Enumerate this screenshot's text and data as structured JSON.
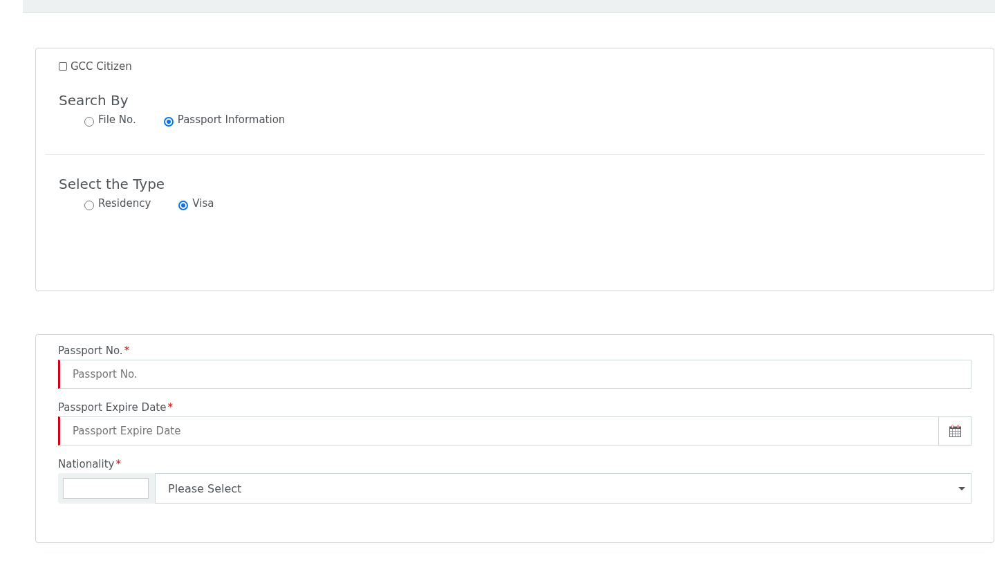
{
  "gcc_citizen": {
    "label": "GCC Citizen",
    "checked": false
  },
  "search_by": {
    "heading": "Search By",
    "options": [
      {
        "label": "File No.",
        "selected": false
      },
      {
        "label": "Passport Information",
        "selected": true
      }
    ]
  },
  "select_type": {
    "heading": "Select the Type",
    "options": [
      {
        "label": "Residency",
        "selected": false
      },
      {
        "label": "Visa",
        "selected": true
      }
    ]
  },
  "fields": [
    {
      "kind": "text",
      "label": "Passport No.",
      "required_mark": "*",
      "placeholder": "Passport No.",
      "required": true
    },
    {
      "kind": "date",
      "label": "Passport Expire Date",
      "required_mark": "*",
      "placeholder": "Passport Expire Date",
      "required": true
    },
    {
      "kind": "select",
      "label": "Nationality",
      "required_mark": "*",
      "value": "Please Select",
      "required": true
    }
  ]
}
